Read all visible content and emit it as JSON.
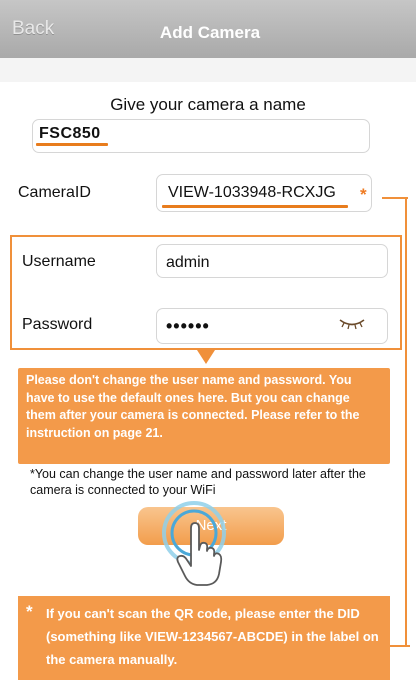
{
  "navbar": {
    "back_label": "Back",
    "title": "Add Camera"
  },
  "form": {
    "name_prompt": "Give your camera a name",
    "camera_name": "FSC850",
    "camera_id_label": "CameraID",
    "camera_id_value": "VIEW-1033948-RCXJG",
    "asterisk": "*",
    "username_label": "Username",
    "username_value": "admin",
    "password_label": "Password",
    "password_mask": "••••••"
  },
  "callout_text": "Please don't change the user name and password. You have to use the default ones here. But you can change them after your camera is connected. Please refer to the instruction on page 21.",
  "hint_text": "*You can change the user name and password later after the camera is connected to your WiFi",
  "next_label": "Next",
  "note": {
    "star": "*",
    "text": "If you can't scan the QR code, please enter the DID (something like VIEW-1234567-ABCDE) in the label on the camera manually."
  },
  "colors": {
    "accent": "#f0903a",
    "callout": "#f39a4a",
    "navbar": "#b5b5b5"
  },
  "icons": {
    "eye": "eye-closed-icon",
    "tap": "hand-tap-icon",
    "ring": "tap-ring-icon"
  }
}
